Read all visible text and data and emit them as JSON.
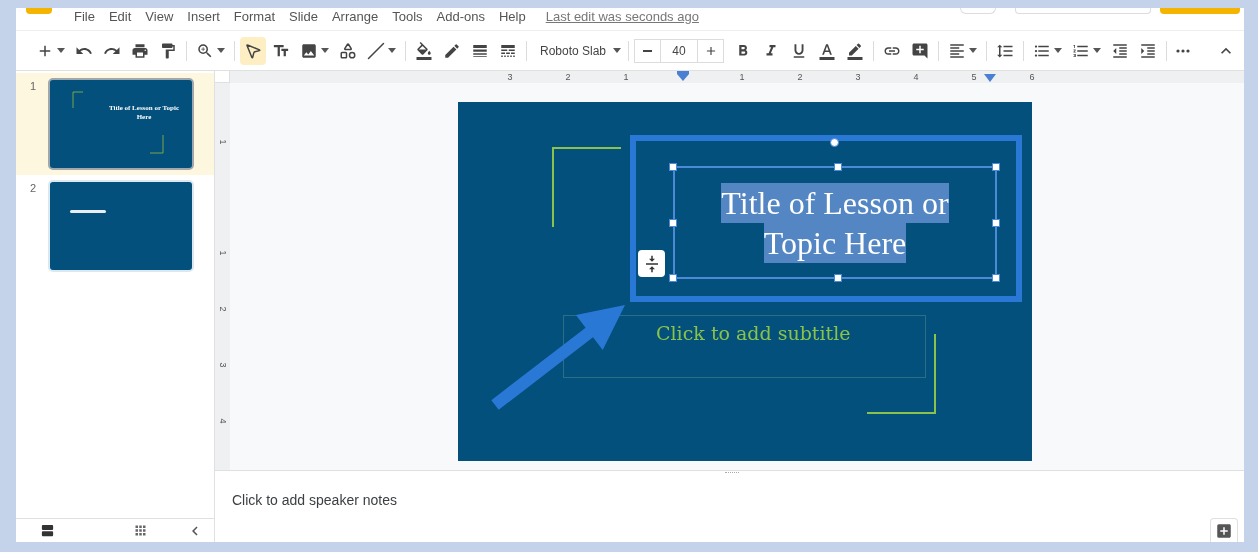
{
  "menu": {
    "items": [
      "File",
      "Edit",
      "View",
      "Insert",
      "Format",
      "Slide",
      "Arrange",
      "Tools",
      "Add-ons",
      "Help"
    ],
    "last_edit": "Last edit was seconds ago"
  },
  "toolbar": {
    "left_groups": [
      [
        {
          "kind": "new",
          "dropdown": true,
          "selected": false
        },
        {
          "kind": "undo",
          "dropdown": false,
          "selected": false
        },
        {
          "kind": "redo",
          "dropdown": false,
          "selected": false
        },
        {
          "kind": "print",
          "dropdown": false,
          "selected": false
        },
        {
          "kind": "paint_format",
          "dropdown": false,
          "selected": false
        }
      ],
      [
        {
          "kind": "zoom",
          "dropdown": true,
          "selected": false
        }
      ],
      [
        {
          "kind": "select",
          "dropdown": false,
          "selected": true
        },
        {
          "kind": "text_box",
          "dropdown": false,
          "selected": false
        },
        {
          "kind": "image",
          "dropdown": true,
          "selected": false
        },
        {
          "kind": "shape",
          "dropdown": false,
          "selected": false
        },
        {
          "kind": "line",
          "dropdown": true,
          "selected": false
        }
      ],
      [
        {
          "kind": "fill",
          "dropdown": false,
          "selected": false
        },
        {
          "kind": "border_color",
          "dropdown": false,
          "selected": false
        },
        {
          "kind": "border_weight",
          "dropdown": false,
          "selected": false
        },
        {
          "kind": "border_dash",
          "dropdown": false,
          "selected": false
        }
      ]
    ],
    "font": "Roboto Slab",
    "font_size": "40",
    "right_groups": [
      [
        {
          "kind": "bold",
          "dropdown": false,
          "selected": false
        },
        {
          "kind": "italic",
          "dropdown": false,
          "selected": false
        },
        {
          "kind": "underline",
          "dropdown": false,
          "selected": false
        },
        {
          "kind": "text_color",
          "dropdown": false,
          "selected": false
        },
        {
          "kind": "highlight",
          "dropdown": false,
          "selected": false
        }
      ],
      [
        {
          "kind": "link",
          "dropdown": false,
          "selected": false
        },
        {
          "kind": "comment",
          "dropdown": false,
          "selected": false
        }
      ],
      [
        {
          "kind": "align",
          "dropdown": true,
          "selected": false
        }
      ],
      [
        {
          "kind": "line_spacing",
          "dropdown": false,
          "selected": false
        }
      ],
      [
        {
          "kind": "bulleted_list",
          "dropdown": true,
          "selected": false
        },
        {
          "kind": "numbered_list",
          "dropdown": true,
          "selected": false
        },
        {
          "kind": "indent_less",
          "dropdown": false,
          "selected": false
        },
        {
          "kind": "indent_more",
          "dropdown": false,
          "selected": false
        }
      ],
      [
        {
          "kind": "more",
          "dropdown": false,
          "selected": false
        }
      ]
    ]
  },
  "slides": [
    {
      "number": "1",
      "selected": true,
      "title": "Title of Lesson or Topic Here"
    },
    {
      "number": "2",
      "selected": false
    }
  ],
  "ruler": {
    "horizontal": [
      "3",
      "2",
      "1",
      "1",
      "2",
      "3",
      "4",
      "5",
      "6"
    ],
    "vertical": [
      "1",
      "1",
      "2",
      "3",
      "4"
    ]
  },
  "slide": {
    "title_lines": [
      "Title of Lesson or",
      "Topic Here"
    ],
    "title_selected": true,
    "subtitle_placeholder": "Click to add subtitle"
  },
  "notes": {
    "placeholder": "Click to add speaker notes"
  }
}
